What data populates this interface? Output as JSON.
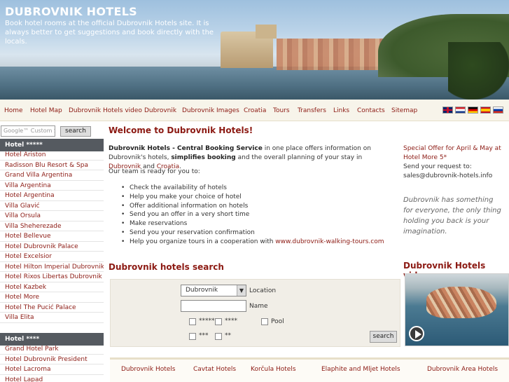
{
  "header": {
    "title": "DUBROVNIK HOTELS",
    "tagline": "Book hotel rooms at the official Dubrovnik Hotels site. It is always better to get suggestions and book directly with the locals."
  },
  "nav": {
    "items": [
      "Home",
      "Hotel Map",
      "Dubrovnik Hotels video",
      "Dubrovnik",
      "Dubrovnik Images",
      "Croatia",
      "Tours",
      "Transfers",
      "Links",
      "Contacts",
      "Sitemap"
    ]
  },
  "flags": [
    "uk-flag-icon",
    "croatia-flag-icon",
    "germany-flag-icon",
    "spain-flag-icon",
    "russia-flag-icon"
  ],
  "google_search": {
    "placeholder": "Google™ Custom Search",
    "button": "search"
  },
  "sidebar": {
    "group1_title": "Hotel *****",
    "group1_items": [
      "Hotel Ariston",
      "Radisson Blu Resort & Spa",
      "Grand Villa Argentina",
      "Villa Argentina",
      "Hotel Argentina",
      "Villa Glavić",
      "Villa Orsula",
      "Villa Sheherezade",
      "Hotel Bellevue",
      "Hotel Dubrovnik Palace",
      "Hotel Excelsior",
      "Hotel Hilton Imperial Dubrovnik",
      "Hotel Rixos Libertas Dubrovnik",
      "Hotel Kazbek",
      "Hotel More",
      "Hotel The Pucić Palace",
      "Villa Elita"
    ],
    "group2_title": "Hotel ****",
    "group2_items": [
      "Grand Hotel Park",
      "Hotel Dubrovnik President",
      "Hotel Lacroma",
      "Hotel Lapad"
    ]
  },
  "main": {
    "title": "Welcome to Dubrovnik Hotels!",
    "intro_bold1": "Dubrovnik Hotels - Central Booking Service",
    "intro_text1": " in one place offers information on Dubrovnik's hotels, ",
    "intro_bold2": "simplifies booking",
    "intro_text2": " and the overall planning of your stay in ",
    "intro_link1": "Dubrovnik",
    "intro_text3": " and ",
    "intro_link2": "Croatia",
    "intro_text4": ".",
    "ready_text": "Our team is ready for you to:",
    "bullets": [
      "Check the availability of hotels",
      "Help you make your choice of hotel",
      "Offer additional information on hotels",
      "Send you an offer in a very short time",
      "Make reservations",
      "Send you your reservation confirmation"
    ],
    "bullet_last_text": "Help you organize tours in a cooperation with ",
    "bullet_last_link": "www.dubrovnik-walking-tours.com"
  },
  "hotel_search": {
    "title": "Dubrovnik hotels search",
    "location_value": "Dubrovnik",
    "location_label": "Location",
    "name_label": "Name",
    "star5": "*****",
    "star4": "****",
    "star3": "***",
    "star2": "**",
    "pool": "Pool",
    "button": "search"
  },
  "bottom_links": [
    "Dubrovnik Hotels",
    "Cavtat Hotels",
    "Korčula Hotels",
    "Elaphite and Mljet Hotels",
    "Dubrovnik Area Hotels"
  ],
  "right": {
    "offer_link": "Special Offer for April & May at Hotel More 5*",
    "offer_text": "Send your request to:",
    "offer_email": "sales@dubrovnik-hotels.info",
    "quote": "Dubrovnik has something for everyone, the only thing holding you back is your imagination.",
    "video_title": "Dubrovnik Hotels video"
  },
  "colors": {
    "accent": "#8c1a13",
    "sidebar_header": "#555a60",
    "nav_bg": "#f7f4ea"
  }
}
